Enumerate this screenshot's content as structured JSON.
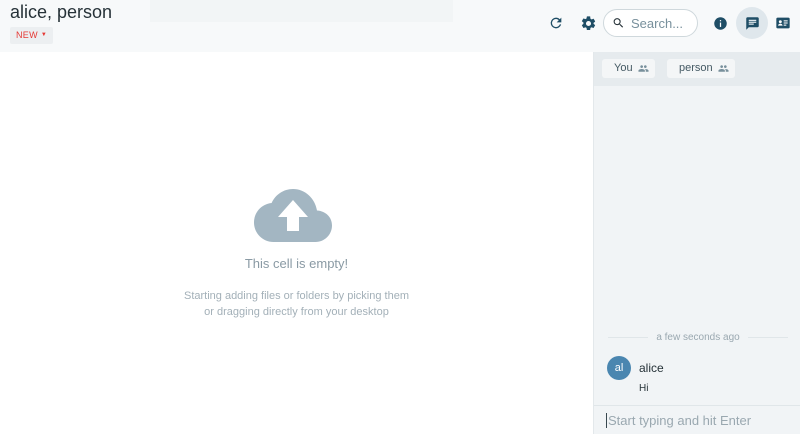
{
  "header": {
    "title": "alice, person",
    "new_label": "NEW",
    "search_placeholder": "Search..."
  },
  "main": {
    "empty_title": "This cell is empty!",
    "empty_line1": "Starting adding files or folders by picking them",
    "empty_line2": "or dragging directly from your desktop"
  },
  "chat": {
    "participants": [
      {
        "label": "You"
      },
      {
        "label": "person"
      }
    ],
    "time_label": "a few seconds ago",
    "message": {
      "avatar": "al",
      "author": "alice",
      "text": "Hi"
    },
    "composer_placeholder": "Start typing and hit Enter"
  },
  "icons": {
    "refresh": "refresh-icon",
    "settings": "gear-icon",
    "search": "search-icon",
    "info": "info-icon",
    "chat": "chat-icon",
    "card": "contact-card-icon",
    "upload": "cloud-upload-icon",
    "people": "people-icon"
  },
  "colors": {
    "accent": "#4a86b0",
    "new_label": "#e53935",
    "icon": "#1f4e66",
    "cloud": "#a3b6c2"
  }
}
